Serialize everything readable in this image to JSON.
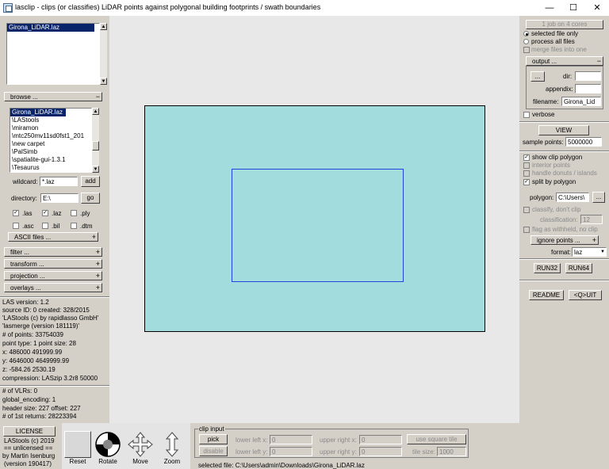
{
  "window": {
    "title": "lasclip - clips (or classifies) LiDAR points against polygonal building footprints / swath boundaries",
    "minimize": "—",
    "maximize": "☐",
    "close": "✕"
  },
  "left": {
    "top_list": {
      "items": [
        "Girona_LiDAR.laz"
      ]
    },
    "browse": {
      "header": "browse ...",
      "sign": "−",
      "items": [
        "Girona_LiDAR.laz",
        "\\LAStools",
        "\\miramon",
        "\\mtc250mv11sd0fst1_201",
        "\\new carpet",
        "\\PalSimb",
        "\\spatialite-gui-1.3.1",
        "\\Tesaurus"
      ],
      "wildcard_label": "wildcard:",
      "wildcard_value": "*.laz",
      "add": "add",
      "directory_label": "directory:",
      "directory_value": "E:\\",
      "go": "go",
      "types": [
        {
          "label": ".las",
          "checked": true
        },
        {
          "label": ".laz",
          "checked": true
        },
        {
          "label": ".ply",
          "checked": false
        },
        {
          "label": ".asc",
          "checked": false
        },
        {
          "label": ".bil",
          "checked": false
        },
        {
          "label": ".dtm",
          "checked": false
        }
      ],
      "ascii": "ASCII files ...",
      "ascii_sign": "+"
    },
    "sections": [
      {
        "label": "filter ...",
        "sign": "+"
      },
      {
        "label": "transform ...",
        "sign": "+"
      },
      {
        "label": "projection ...",
        "sign": "+"
      },
      {
        "label": "overlays ...",
        "sign": "+"
      }
    ],
    "info1": [
      "LAS version: 1.2",
      "source ID:      0 created: 328/2015",
      "'LAStools (c) by rapidlasso GmbH'",
      "'lasmerge (version 181119)'",
      "# of points: 33754039",
      "point type: 1 point size: 28",
      "x: 486000 491999.99",
      "y: 4646000 4649999.99",
      "z: -584.26 2530.19",
      "compression: LASzip 3.2r8 50000"
    ],
    "info2": [
      "# of VLRs: 0",
      "global_encoding: 1",
      "header size: 227 offset: 227",
      "# of 1st returns: 28223394"
    ],
    "license": {
      "button": "LICENSE",
      "lines": [
        "LAStools (c) 2019",
        "== unlicensed ==",
        "by Martin Isenburg",
        "(version 190417)"
      ]
    }
  },
  "toolbar": {
    "reset": "Reset",
    "rotate": "Rotate",
    "move": "Move",
    "zoom": "Zoom"
  },
  "clip": {
    "legend": "clip input",
    "pick": "pick",
    "disable": "disable",
    "lower_left_x": "lower left x:",
    "lower_left_x_val": "0",
    "lower_left_y": "lower left y:",
    "lower_left_y_val": "0",
    "upper_right_x": "upper right x:",
    "upper_right_x_val": "0",
    "upper_right_y": "upper right y:",
    "upper_right_y_val": "0",
    "square": "use square tile",
    "tile_size_label": "tile size:",
    "tile_size": "1000"
  },
  "status": {
    "selected": "selected file: C:\\Users\\admin\\Downloads\\Girona_LiDAR.laz"
  },
  "right": {
    "cores": "1 job on 4 cores",
    "selected_only": "selected file only",
    "process_all": "process all files",
    "merge": "merge files into one",
    "output": {
      "header": "output ...",
      "sign": "−",
      "dots": "...",
      "dir_label": "dir:",
      "dir_value": "",
      "appendix_label": "appendix:",
      "appendix_value": "",
      "filename_label": "filename:",
      "filename_value": "Girona_Lid"
    },
    "verbose": "verbose",
    "view": "VIEW",
    "sample_label": "sample points:",
    "sample_value": "5000000",
    "show_clip": "show clip polygon",
    "interior": "interior points",
    "donuts": "handle donuts / islands",
    "split": "split by polygon",
    "polygon_label": "polygon:",
    "polygon_value": "C:\\Users\\",
    "polygon_btn": "...",
    "classify": "classify, don't clip",
    "classification_label": "classification:",
    "classification_value": "12",
    "flag": "flag as withheld, no clip",
    "ignore": "ignore points ...",
    "ignore_sign": "+",
    "format_label": "format:",
    "format_value": "laz",
    "run32": "RUN32",
    "run64": "RUN64",
    "readme": "README",
    "quit": "<Q>UIT"
  },
  "colors": {
    "extent_fill": "#a3dcdc",
    "clip_polygon": "#2244dd",
    "panel": "#d4d0c8",
    "viewport": "#e8e8e8"
  }
}
